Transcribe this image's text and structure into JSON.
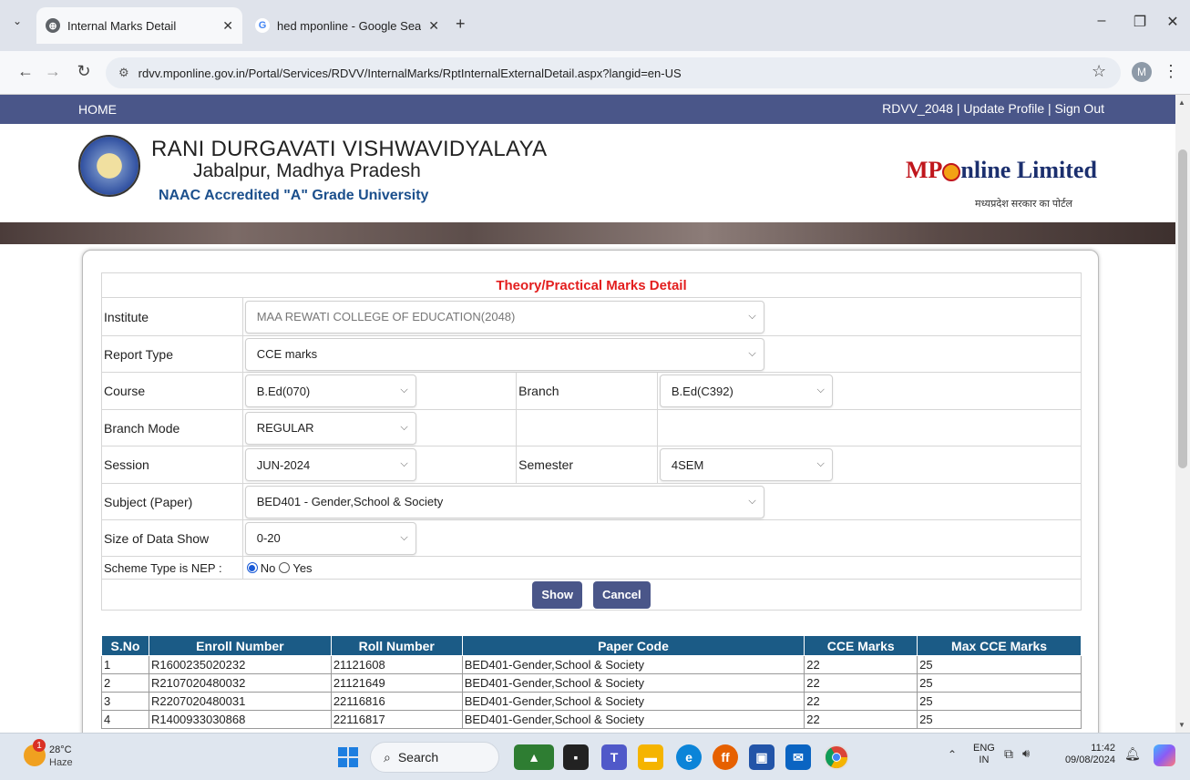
{
  "browser": {
    "tabs": [
      {
        "title": "Internal Marks Detail",
        "active": true
      },
      {
        "title": "hed mponline - Google Search",
        "active": false
      }
    ],
    "url": "rdvv.mponline.gov.in/Portal/Services/RDVV/InternalMarks/RptInternalExternalDetail.aspx?langid=en-US",
    "profile_initial": "M"
  },
  "nav": {
    "home": "HOME",
    "user_links": "RDVV_2048 | Update Profile | Sign Out"
  },
  "header": {
    "university": "RANI DURGAVATI VISHWAVIDYALAYA",
    "location": "Jabalpur, Madhya Pradesh",
    "grade": "NAAC Accredited \"A\" Grade University",
    "partner_logo": {
      "mp": "MP",
      "rest": "nline Limited"
    },
    "partner_sub": "मध्यप्रदेश सरकार का पोर्टल"
  },
  "form": {
    "title": "Theory/Practical Marks Detail",
    "institute_label": "Institute",
    "institute_value": "MAA REWATI COLLEGE OF EDUCATION(2048)",
    "report_type_label": "Report Type",
    "report_type_value": "CCE marks",
    "course_label": "Course",
    "course_value": "B.Ed(070)",
    "branch_label": "Branch",
    "branch_value": "B.Ed(C392)",
    "branch_mode_label": "Branch Mode",
    "branch_mode_value": "REGULAR",
    "session_label": "Session",
    "session_value": "JUN-2024",
    "semester_label": "Semester",
    "semester_value": "4SEM",
    "subject_label": "Subject (Paper)",
    "subject_value": "BED401 - Gender,School & Society",
    "size_label": "Size of Data Show",
    "size_value": "0-20",
    "scheme_label": "Scheme Type is NEP :",
    "scheme_no": "No",
    "scheme_yes": "Yes",
    "show_button": "Show",
    "cancel_button": "Cancel"
  },
  "table": {
    "headers": [
      "S.No",
      "Enroll Number",
      "Roll Number",
      "Paper Code",
      "CCE Marks",
      "Max CCE Marks"
    ],
    "rows": [
      [
        "1",
        "R1600235020232",
        "21121608",
        "BED401-Gender,School & Society",
        "22",
        "25"
      ],
      [
        "2",
        "R2107020480032",
        "21121649",
        "BED401-Gender,School & Society",
        "22",
        "25"
      ],
      [
        "3",
        "R2207020480031",
        "22116816",
        "BED401-Gender,School & Society",
        "22",
        "25"
      ],
      [
        "4",
        "R1400933030868",
        "22116817",
        "BED401-Gender,School & Society",
        "22",
        "25"
      ]
    ]
  },
  "taskbar": {
    "weather_temp": "28°C",
    "weather_desc": "Haze",
    "weather_badge": "1",
    "search": "Search",
    "lang": "ENG",
    "region": "IN",
    "time": "11:42",
    "date": "09/08/2024"
  }
}
